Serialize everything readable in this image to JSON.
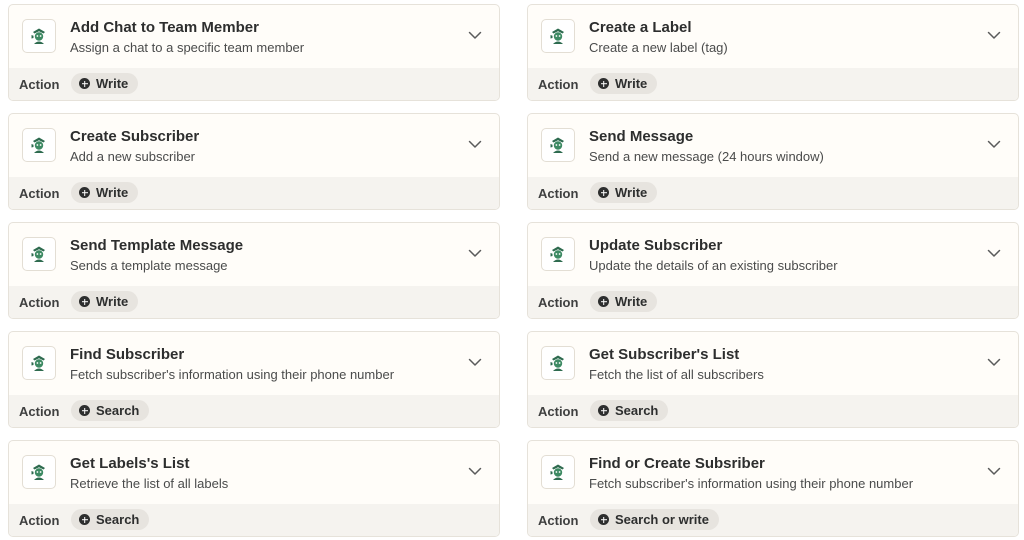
{
  "colors": {
    "app_icon_green": "#2e6b4f",
    "badge_bg": "#e7e4df",
    "footer_bg": "#f5f3ef"
  },
  "icons": {
    "app": "app-logo-icon",
    "expand": "chevron-down-icon",
    "badge": "plus-circle-icon"
  },
  "cards": [
    {
      "title": "Add Chat to Team Member",
      "description": "Assign a chat to a specific team member",
      "kind": "Action",
      "badge": "Write"
    },
    {
      "title": "Create a Label",
      "description": "Create a new label (tag)",
      "kind": "Action",
      "badge": "Write"
    },
    {
      "title": "Create Subscriber",
      "description": "Add a new subscriber",
      "kind": "Action",
      "badge": "Write"
    },
    {
      "title": "Send Message",
      "description": "Send a new message (24 hours window)",
      "kind": "Action",
      "badge": "Write"
    },
    {
      "title": "Send Template Message",
      "description": "Sends a template message",
      "kind": "Action",
      "badge": "Write"
    },
    {
      "title": "Update Subscriber",
      "description": "Update the details of an existing subscriber",
      "kind": "Action",
      "badge": "Write"
    },
    {
      "title": "Find Subscriber",
      "description": "Fetch subscriber's information using their phone number",
      "kind": "Action",
      "badge": "Search"
    },
    {
      "title": "Get Subscriber's List",
      "description": "Fetch the list of all subscribers",
      "kind": "Action",
      "badge": "Search"
    },
    {
      "title": "Get Labels's List",
      "description": "Retrieve the list of all labels",
      "kind": "Action",
      "badge": "Search"
    },
    {
      "title": "Find or Create Subsriber",
      "description": "Fetch subscriber's information using their phone number",
      "kind": "Action",
      "badge": "Search or write"
    }
  ]
}
